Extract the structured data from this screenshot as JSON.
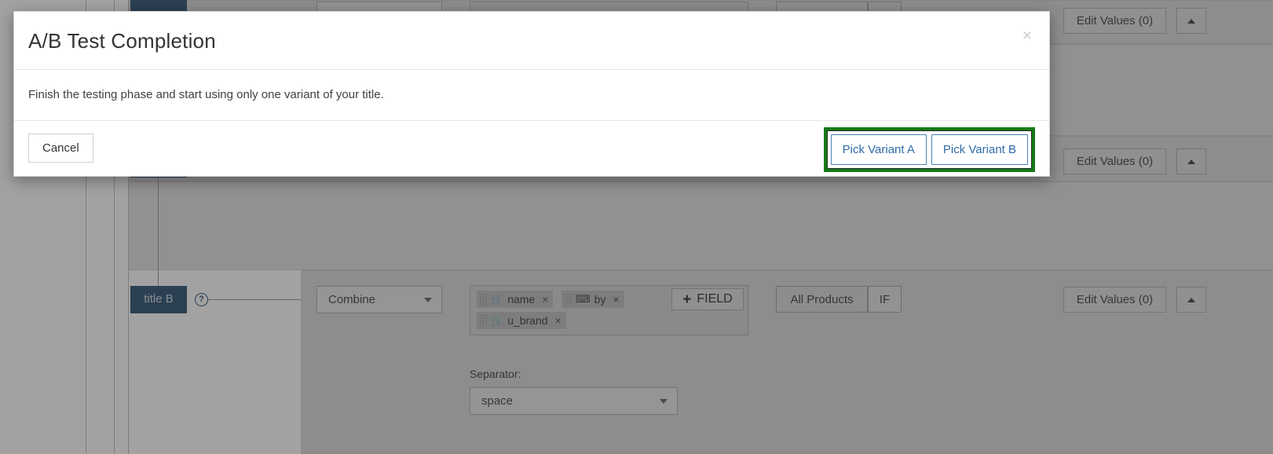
{
  "modal": {
    "title": "A/B Test Completion",
    "close_label": "×",
    "body_text": "Finish the testing phase and start using only one variant of your title.",
    "cancel_label": "Cancel",
    "primary_actions": [
      {
        "label": "Pick Variant A"
      },
      {
        "label": "Pick Variant B"
      }
    ],
    "highlight_color": "#167a16"
  },
  "background": {
    "rows": [
      {
        "edit_values_label": "Edit Values (0)",
        "collapse_icon": "caret-up-icon"
      },
      {
        "edit_values_label": "Edit Values (0)",
        "collapse_icon": "caret-up-icon"
      },
      {
        "node_label": "title B",
        "help_icon": "question-mark-icon",
        "operation": "Combine",
        "operation_caret": "caret-down-icon",
        "fields": [
          {
            "label": "name",
            "icon": "cart-icon",
            "remove": "×"
          },
          {
            "label": "by",
            "icon": "keyboard-icon",
            "remove": "×"
          },
          {
            "label": "u_brand",
            "icon": "cart-icon",
            "remove": "×"
          }
        ],
        "add_field_label": "FIELD",
        "add_field_icon": "plus-icon",
        "scope_label": "All Products",
        "condition_label": "IF",
        "separator_label": "Separator:",
        "separator_value": "space",
        "separator_caret": "caret-down-icon",
        "edit_values_label": "Edit Values (0)",
        "collapse_icon": "caret-up-icon"
      }
    ]
  }
}
